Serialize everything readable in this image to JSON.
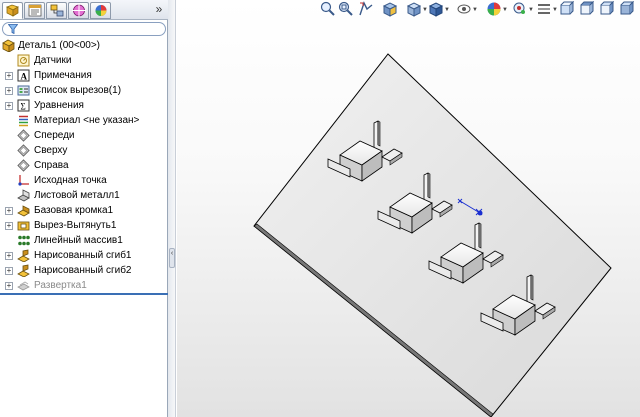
{
  "panel": {
    "tabs": [
      {
        "name": "featuremanager-tab",
        "icon": "feature-tree-icon",
        "active": true
      },
      {
        "name": "propertymanager-tab",
        "icon": "property-icon",
        "active": false
      },
      {
        "name": "configurationmanager-tab",
        "icon": "configuration-icon",
        "active": false
      },
      {
        "name": "dimxpert-tab",
        "icon": "crosshair-icon",
        "active": false
      },
      {
        "name": "display-manager-tab",
        "icon": "appearance-icon",
        "active": false
      }
    ],
    "more_label": "»",
    "filter_placeholder": ""
  },
  "tree": {
    "root": "Деталь1  (00<00>)",
    "items": [
      {
        "label": "Датчики",
        "expandable": false,
        "icon": "sensor-icon"
      },
      {
        "label": "Примечания",
        "expandable": true,
        "icon": "annotation-icon"
      },
      {
        "label": "Список вырезов(1)",
        "expandable": true,
        "icon": "cutlist-icon"
      },
      {
        "label": "Уравнения",
        "expandable": true,
        "icon": "equation-icon"
      },
      {
        "label": "Материал <не указан>",
        "expandable": false,
        "icon": "material-icon"
      },
      {
        "label": "Спереди",
        "expandable": false,
        "icon": "plane-icon"
      },
      {
        "label": "Сверху",
        "expandable": false,
        "icon": "plane-icon"
      },
      {
        "label": "Справа",
        "expandable": false,
        "icon": "plane-icon"
      },
      {
        "label": "Исходная точка",
        "expandable": false,
        "icon": "origin-icon"
      },
      {
        "label": "Листовой металл1",
        "expandable": false,
        "icon": "sheetmetal-icon"
      },
      {
        "label": "Базовая кромка1",
        "expandable": true,
        "icon": "base-flange-icon"
      },
      {
        "label": "Вырез-Вытянуть1",
        "expandable": true,
        "icon": "extruded-cut-icon"
      },
      {
        "label": "Линейный массив1",
        "expandable": false,
        "icon": "linear-pattern-icon"
      },
      {
        "label": "Нарисованный сгиб1",
        "expandable": true,
        "icon": "sketched-bend-icon"
      },
      {
        "label": "Нарисованный сгиб2",
        "expandable": true,
        "icon": "sketched-bend-icon"
      },
      {
        "label": "Развертка1",
        "expandable": true,
        "icon": "flatten-icon",
        "suppressed": true
      }
    ]
  },
  "splitter": {
    "handle_label": "‹"
  },
  "viewport": {
    "toolbar": [
      "zoom-to-fit-icon",
      "zoom-to-area-icon",
      "previous-view-icon",
      "section-view-icon",
      "view-orientation-icon",
      "display-style-icon",
      "hide-show-icon",
      "edit-appearance-icon",
      "apply-scene-icon",
      "view-settings-icon",
      "view-front-icon",
      "view-top-icon",
      "view-right-icon",
      "view-iso-icon"
    ]
  },
  "colors": {
    "accent": "#3a6fb5",
    "selection": "#1a2fd0",
    "part_edge": "#000000"
  }
}
